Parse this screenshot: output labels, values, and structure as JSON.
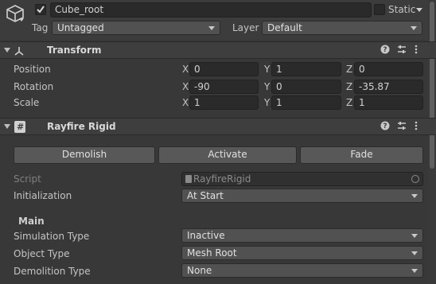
{
  "object": {
    "name": "Cube_root",
    "static_label": "Static",
    "tag_label": "Tag",
    "tag_value": "Untagged",
    "layer_label": "Layer",
    "layer_value": "Default"
  },
  "transform": {
    "title": "Transform",
    "position_label": "Position",
    "rotation_label": "Rotation",
    "scale_label": "Scale",
    "axis_x": "X",
    "axis_y": "Y",
    "axis_z": "Z",
    "position": {
      "x": "0",
      "y": "1",
      "z": "0"
    },
    "rotation": {
      "x": "-90",
      "y": "0",
      "z": "-35.87"
    },
    "scale": {
      "x": "1",
      "y": "1",
      "z": "1"
    }
  },
  "rayfire": {
    "title": "Rayfire Rigid",
    "demolish_label": "Demolish",
    "activate_label": "Activate",
    "fade_label": "Fade",
    "script_label": "Script",
    "script_value": "RayfireRigid",
    "initialization_label": "Initialization",
    "initialization_value": "At Start",
    "main_section": "Main",
    "simulation_type_label": "Simulation Type",
    "simulation_type_value": "Inactive",
    "object_type_label": "Object Type",
    "object_type_value": "Mesh Root",
    "demolition_type_label": "Demolition Type",
    "demolition_type_value": "None"
  },
  "icons": {
    "object": "cube-icon",
    "transform": "transform-axes-icon",
    "script": "script-file-icon",
    "help": "help-icon",
    "presets": "presets-sliders-icon",
    "menu": "kebab-menu-icon"
  }
}
